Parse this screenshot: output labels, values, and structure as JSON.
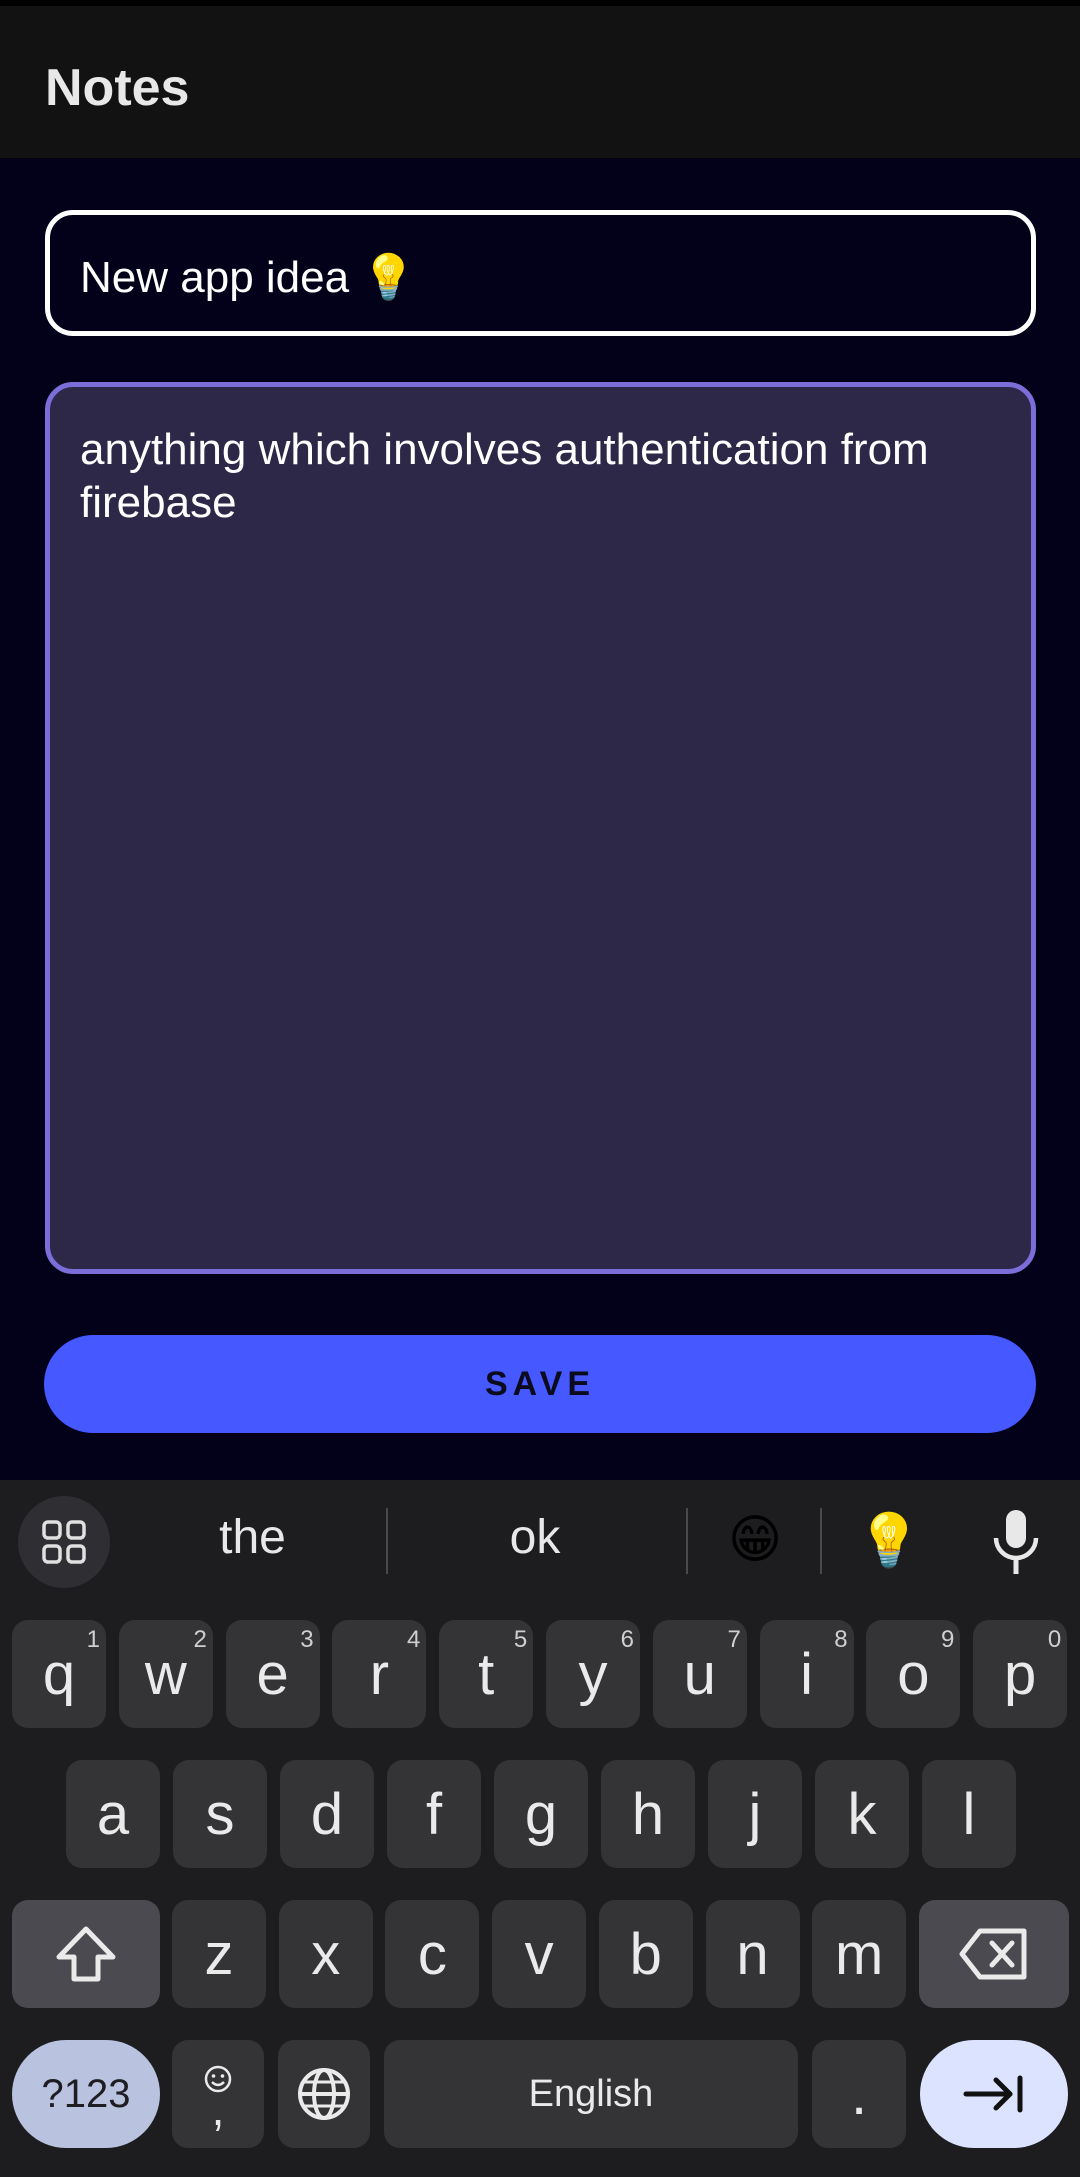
{
  "appbar": {
    "title": "Notes"
  },
  "note": {
    "title_value": "New app idea 💡",
    "body_value": "anything which involves authentication from firebase"
  },
  "save_button": {
    "label": "SAVE"
  },
  "keyboard": {
    "suggestions": [
      "the",
      "ok"
    ],
    "emoji_suggestions": [
      "😁",
      "💡"
    ],
    "row1": [
      {
        "k": "q",
        "s": "1"
      },
      {
        "k": "w",
        "s": "2"
      },
      {
        "k": "e",
        "s": "3"
      },
      {
        "k": "r",
        "s": "4"
      },
      {
        "k": "t",
        "s": "5"
      },
      {
        "k": "y",
        "s": "6"
      },
      {
        "k": "u",
        "s": "7"
      },
      {
        "k": "i",
        "s": "8"
      },
      {
        "k": "o",
        "s": "9"
      },
      {
        "k": "p",
        "s": "0"
      }
    ],
    "row2": [
      "a",
      "s",
      "d",
      "f",
      "g",
      "h",
      "j",
      "k",
      "l"
    ],
    "row3": [
      "z",
      "x",
      "c",
      "v",
      "b",
      "n",
      "m"
    ],
    "mode_key": "?123",
    "comma_key": ",",
    "space_label": "English",
    "period_key": ".",
    "icons": {
      "grid": "apps-grid-icon",
      "mic": "microphone-icon",
      "shift": "shift-icon",
      "backspace": "backspace-icon",
      "emoji": "emoji-icon",
      "globe": "globe-icon",
      "enter": "next-field-icon"
    }
  },
  "colors": {
    "background": "#03001a",
    "appbar": "#121212",
    "body_field": "#2d2748",
    "body_border": "#7b6ed9",
    "save_button": "#4658ff",
    "keyboard": "#1d1d1f",
    "key": "#343437"
  }
}
